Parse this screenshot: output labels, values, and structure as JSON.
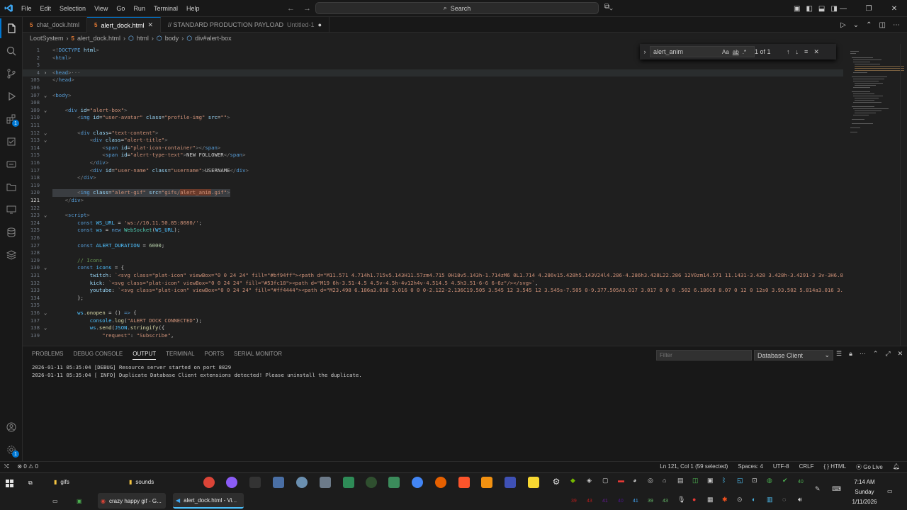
{
  "titlebar": {
    "menu": [
      "File",
      "Edit",
      "Selection",
      "View",
      "Go",
      "Run",
      "Terminal",
      "Help"
    ],
    "search_placeholder": "Search"
  },
  "tabs": [
    {
      "label": "chat_dock.html",
      "active": false
    },
    {
      "label": "alert_dock.html",
      "active": true
    },
    {
      "label": "// STANDARD PRODUCTION PAYLOAD",
      "suffix": "Untitled-1",
      "active": false
    }
  ],
  "breadcrumb": [
    "LootSystem",
    "alert_dock.html",
    "html",
    "body",
    "div#alert-box"
  ],
  "find": {
    "value": "alert_anim",
    "count": "1 of 1",
    "case": "Aa",
    "word": "ab",
    "regex": ".*"
  },
  "activity_badges": {
    "extensions": "1",
    "accounts": "1",
    "settings": "1"
  },
  "editor": {
    "lines": [
      {
        "n": "1",
        "html": "<span class=\"t\">&lt;!</span><span class=\"tag\">DOCTYPE</span> <span class=\"at\">html</span><span class=\"t\">&gt;</span>"
      },
      {
        "n": "2",
        "html": "<span class=\"t\">&lt;</span><span class=\"tag\">html</span><span class=\"t\">&gt;</span>"
      },
      {
        "n": "3",
        "html": ""
      },
      {
        "n": "4",
        "fold": ">",
        "sel": true,
        "html": "<span class=\"t\">&lt;</span><span class=\"tag\">head</span><span class=\"t\">&gt;</span><span class=\"dim\">···</span>"
      },
      {
        "n": "105",
        "html": "<span class=\"t\">&lt;/</span><span class=\"tag\">head</span><span class=\"t\">&gt;</span>"
      },
      {
        "n": "106",
        "html": ""
      },
      {
        "n": "107",
        "fold": "v",
        "html": "<span class=\"t\">&lt;</span><span class=\"tag\">body</span><span class=\"t\">&gt;</span>"
      },
      {
        "n": "108",
        "html": ""
      },
      {
        "n": "109",
        "fold": "v",
        "html": "    <span class=\"t\">&lt;</span><span class=\"tag\">div</span> <span class=\"at\">id</span>=<span class=\"st\">\"alert-box\"</span><span class=\"t\">&gt;</span>"
      },
      {
        "n": "110",
        "html": "        <span class=\"t\">&lt;</span><span class=\"tag\">img</span> <span class=\"at\">id</span>=<span class=\"st\">\"user-avatar\"</span> <span class=\"at\">class</span>=<span class=\"st\">\"profile-img\"</span> <span class=\"at\">src</span>=<span class=\"st\">\"\"</span><span class=\"t\">&gt;</span>"
      },
      {
        "n": "111",
        "html": ""
      },
      {
        "n": "112",
        "fold": "v",
        "html": "        <span class=\"t\">&lt;</span><span class=\"tag\">div</span> <span class=\"at\">class</span>=<span class=\"st\">\"text-content\"</span><span class=\"t\">&gt;</span>"
      },
      {
        "n": "113",
        "fold": "v",
        "html": "            <span class=\"t\">&lt;</span><span class=\"tag\">div</span> <span class=\"at\">class</span>=<span class=\"st\">\"alert-title\"</span><span class=\"t\">&gt;</span>"
      },
      {
        "n": "114",
        "html": "                <span class=\"t\">&lt;</span><span class=\"tag\">span</span> <span class=\"at\">id</span>=<span class=\"st\">\"plat-icon-container\"</span><span class=\"t\">&gt;&lt;/</span><span class=\"tag\">span</span><span class=\"t\">&gt;</span>"
      },
      {
        "n": "115",
        "html": "                <span class=\"t\">&lt;</span><span class=\"tag\">span</span> <span class=\"at\">id</span>=<span class=\"st\">\"alert-type-text\"</span><span class=\"t\">&gt;</span>NEW FOLLOWER<span class=\"t\">&lt;/</span><span class=\"tag\">span</span><span class=\"t\">&gt;</span>"
      },
      {
        "n": "116",
        "html": "            <span class=\"t\">&lt;/</span><span class=\"tag\">div</span><span class=\"t\">&gt;</span>"
      },
      {
        "n": "117",
        "html": "            <span class=\"t\">&lt;</span><span class=\"tag\">div</span> <span class=\"at\">id</span>=<span class=\"st\">\"user-name\"</span> <span class=\"at\">class</span>=<span class=\"st\">\"username\"</span><span class=\"t\">&gt;</span>USERNAME<span class=\"t\">&lt;/</span><span class=\"tag\">div</span><span class=\"t\">&gt;</span>"
      },
      {
        "n": "118",
        "html": "        <span class=\"t\">&lt;/</span><span class=\"tag\">div</span><span class=\"t\">&gt;</span>"
      },
      {
        "n": "119",
        "html": ""
      },
      {
        "n": "120",
        "hl": true,
        "html": "        <span class=\"t\">&lt;</span><span class=\"tag\">img</span> <span class=\"at\">class</span>=<span class=\"st\">\"alert-gif\"</span> <span class=\"at\">src</span>=<span class=\"st\">\"gifs/<span style=\"background:#6b3a2a\">alert_anim</span>.gif\"</span><span class=\"t\">&gt;</span>"
      },
      {
        "n": "121",
        "cur": true,
        "html": "    <span class=\"t\">&lt;/</span><span class=\"tag\">div</span><span class=\"t\">&gt;</span>"
      },
      {
        "n": "122",
        "html": ""
      },
      {
        "n": "123",
        "fold": "v",
        "html": "    <span class=\"t\">&lt;</span><span class=\"tag\">script</span><span class=\"t\">&gt;</span>"
      },
      {
        "n": "124",
        "html": "        <span class=\"kw\">const</span> <span class=\"vr\">WS_URL</span> = <span class=\"st\">'ws://10.11.50.85:8080/'</span>;"
      },
      {
        "n": "125",
        "html": "        <span class=\"kw\">const</span> <span class=\"vr\">ws</span> = <span class=\"kw\">new</span> <span class=\"cls\">WebSocket</span>(<span class=\"vr\">WS_URL</span>);"
      },
      {
        "n": "126",
        "html": ""
      },
      {
        "n": "127",
        "html": "        <span class=\"kw\">const</span> <span class=\"vr\">ALERT_DURATION</span> = <span class=\"num\">6000</span>;"
      },
      {
        "n": "128",
        "html": ""
      },
      {
        "n": "129",
        "html": "        <span class=\"cm\">// Icons</span>"
      },
      {
        "n": "130",
        "fold": "v",
        "html": "        <span class=\"kw\">const</span> <span class=\"vr\">icons</span> = {"
      },
      {
        "n": "131",
        "html": "            <span class=\"at\">twitch</span>: <span class=\"st\">`&lt;svg class=\"plat-icon\" viewBox=\"0 0 24 24\" fill=\"#bf94ff\"&gt;&lt;path d=\"M11.571 4.714h1.715v5.143H11.57zm4.715 0H18v5.143h-1.714zM6 0L1.714 4.286v15.428h5.143V24l4.286-4.286h3.428L22.286 12V0zm14.571 11.1431-3.428 3.428h-3.4291-3 3v-3H6.8</span>"
      },
      {
        "n": "132",
        "html": "            <span class=\"at\">kick</span>: <span class=\"st\">`&lt;svg class=\"plat-icon\" viewBox=\"0 0 24 24\" fill=\"#53fc18\"&gt;&lt;path d=\"M19 6h-3.51-4.5 4.5v-4.5h-4v12h4v-4.514.5 4.5h3.51-6-6 6-6z\"/&gt;&lt;/svg&gt;`</span>,"
      },
      {
        "n": "133",
        "html": "            <span class=\"at\">youtube</span>: <span class=\"st\">`&lt;svg class=\"plat-icon\" viewBox=\"0 0 24 24\" fill=\"#ff4444\"&gt;&lt;path d=\"M23.498 6.186a3.016 3.016 0 0 0-2.122-2.136C19.505 3.545 12 3.545 12 3.545s-7.505 0-9.377.505A3.017 3.017 0 0 0 .502 6.186C0 8.07 0 12 0 12s0 3.93.502 5.814a3.016 3.</span>"
      },
      {
        "n": "134",
        "html": "        };"
      },
      {
        "n": "135",
        "html": ""
      },
      {
        "n": "136",
        "fold": "v",
        "html": "        <span class=\"vr\">ws</span>.<span class=\"fn\">onopen</span> = () <span class=\"kw\">=&gt;</span> {"
      },
      {
        "n": "137",
        "html": "            <span class=\"vr\">console</span>.<span class=\"fn\">log</span>(<span class=\"st\">\"ALERT DOCK CONNECTED\"</span>);"
      },
      {
        "n": "138",
        "fold": "v",
        "html": "            <span class=\"vr\">ws</span>.<span class=\"fn\">send</span>(<span class=\"vr\">JSON</span>.<span class=\"fn\">stringify</span>({"
      },
      {
        "n": "139",
        "html": "                <span class=\"st\">\"request\"</span>: <span class=\"st\">\"Subscribe\"</span>,"
      }
    ]
  },
  "panel": {
    "tabs": [
      "PROBLEMS",
      "DEBUG CONSOLE",
      "OUTPUT",
      "TERMINAL",
      "PORTS",
      "SERIAL MONITOR"
    ],
    "active_tab": "OUTPUT",
    "filter_placeholder": "Filter",
    "channel": "Database Client",
    "output": [
      "2026-01-11 05:35:04 [DEBUG] Resource server started on port 8829",
      "2026-01-11 05:35:04 [ INFO] Duplicate Database Client extensions detected! Please uninstall the duplicate."
    ]
  },
  "statusbar": {
    "errors": "0",
    "warnings": "0",
    "position": "Ln 121, Col 1 (59 selected)",
    "spaces": "Spaces: 4",
    "encoding": "UTF-8",
    "eol": "CRLF",
    "language": "HTML",
    "golive": "Go Live"
  },
  "taskbar": {
    "folder1": "gifs",
    "folder2": "sounds",
    "chrome_window": "crazy happy gif - G...",
    "vscode_window": "alert_dock.html - Vi...",
    "tray_numbers": [
      "40",
      "39",
      "43",
      "41",
      "40",
      "41",
      "39",
      "43"
    ],
    "time": "7:14 AM",
    "day": "Sunday",
    "date": "1/11/2026"
  }
}
